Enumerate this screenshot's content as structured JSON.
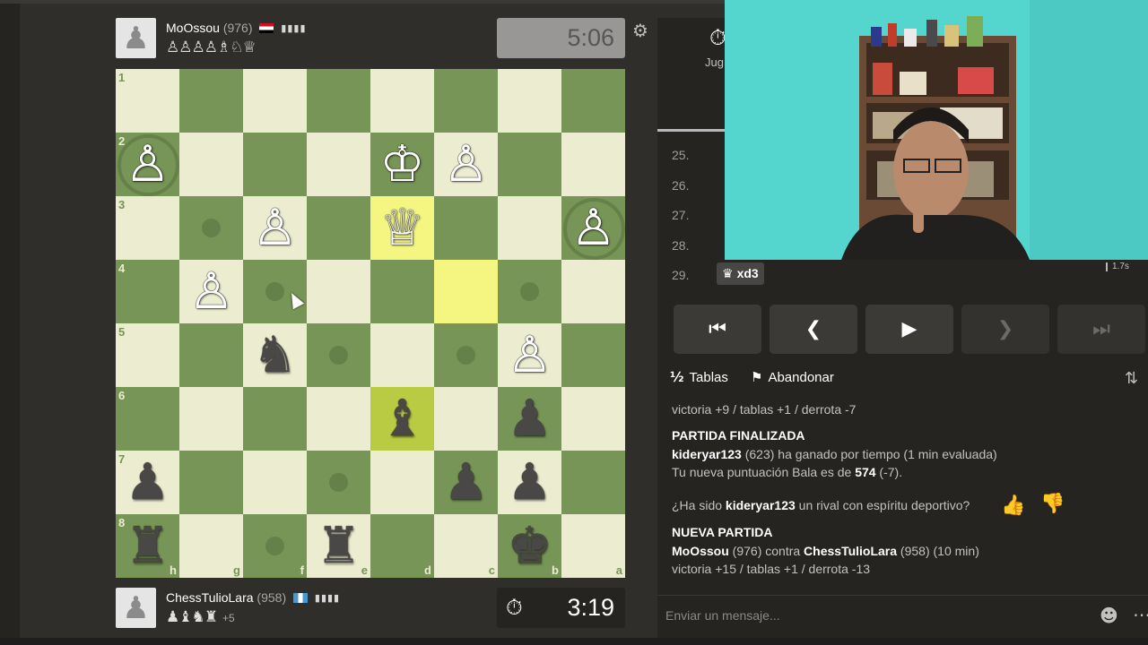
{
  "top_player": {
    "name": "MoOssou",
    "rating": "(976)",
    "captured": "♙♙♙♙♗♘♕",
    "clock": "5:06"
  },
  "bottom_player": {
    "name": "ChessTulioLara",
    "rating": "(958)",
    "captured": "♟♝♞♜",
    "advantage": "+5",
    "clock": "3:19"
  },
  "board": {
    "orientation": "black",
    "files_labels": [
      "h",
      "g",
      "f",
      "e",
      "d",
      "c",
      "b",
      "a"
    ],
    "rank_labels": [
      "1",
      "2",
      "3",
      "4",
      "5",
      "6",
      "7",
      "8"
    ],
    "pieces": [
      {
        "sq": "h2",
        "p": "♙",
        "c": "w"
      },
      {
        "sq": "d2",
        "p": "♔",
        "c": "w"
      },
      {
        "sq": "c2",
        "p": "♙",
        "c": "w"
      },
      {
        "sq": "f3",
        "p": "♙",
        "c": "w"
      },
      {
        "sq": "d3",
        "p": "♕",
        "c": "w"
      },
      {
        "sq": "a3",
        "p": "♙",
        "c": "w"
      },
      {
        "sq": "g4",
        "p": "♙",
        "c": "w"
      },
      {
        "sq": "f5",
        "p": "♞",
        "c": "b"
      },
      {
        "sq": "b5",
        "p": "♙",
        "c": "w"
      },
      {
        "sq": "d6",
        "p": "♝",
        "c": "b"
      },
      {
        "sq": "b6",
        "p": "♟",
        "c": "b"
      },
      {
        "sq": "h7",
        "p": "♟",
        "c": "b"
      },
      {
        "sq": "c7",
        "p": "♟",
        "c": "b"
      },
      {
        "sq": "b7",
        "p": "♟",
        "c": "b"
      },
      {
        "sq": "h8",
        "p": "♜",
        "c": "b"
      },
      {
        "sq": "e8",
        "p": "♜",
        "c": "b"
      },
      {
        "sq": "b8",
        "p": "♚",
        "c": "b"
      }
    ],
    "highlight_squares": [
      "d3",
      "c4",
      "d6"
    ],
    "move_hints": [
      "g3",
      "f4",
      "b4",
      "e5",
      "c5",
      "e7",
      "f8"
    ],
    "capture_hints": [
      "h2",
      "a3"
    ]
  },
  "panel": {
    "tab_label": "Jug",
    "moves": [
      {
        "num": "25.",
        "move": ""
      },
      {
        "num": "26.",
        "move": ""
      },
      {
        "num": "27.",
        "move": ""
      },
      {
        "num": "28.",
        "move": ""
      },
      {
        "num": "29.",
        "move": "xd3",
        "piece": "♛",
        "current": true
      }
    ],
    "time_spent": "1.7s",
    "nav": [
      "⏮",
      "❮",
      "▶",
      "❯",
      "⏭"
    ],
    "draw_label": "Tablas",
    "draw_icon": "½",
    "resign_label": "Abandonar",
    "resign_icon": "flag-icon"
  },
  "chat": {
    "stats_prev": "victoria +9 / tablas +1 / derrota -7",
    "finished_header": "PARTIDA FINALIZADA",
    "winner": "kideryar123",
    "winner_rest": " (623) ha ganado por tiempo (1 min evaluada)",
    "rating_prefix": "Tu nueva puntuación Bala es de ",
    "rating_value": "574",
    "rating_suffix": " (-7).",
    "sport_prefix": "¿Ha sido ",
    "sport_name": "kideryar123",
    "sport_suffix": " un rival con espíritu deportivo?",
    "new_header": "NUEVA PARTIDA",
    "new_p1": "MoOssou",
    "new_p1_rating": " (976) contra ",
    "new_p2": "ChessTulioLara",
    "new_p2_rest": " (958) (10 min)",
    "stats_new": "victoria +15 / tablas +1 / derrota -13",
    "input_placeholder": "Enviar un mensaje..."
  }
}
